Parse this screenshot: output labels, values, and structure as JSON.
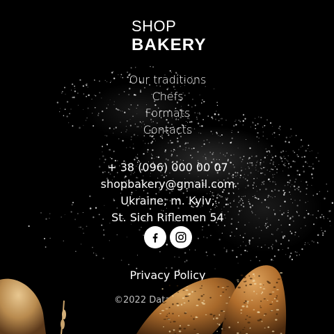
{
  "logo": {
    "line1": "SHOP",
    "line2": "BAKERY"
  },
  "nav": {
    "items": [
      {
        "label": "Our traditions"
      },
      {
        "label": "Chefs"
      },
      {
        "label": "Formats"
      },
      {
        "label": "Contacts"
      }
    ]
  },
  "contacts": {
    "phone": "+ 38 (096) 000 00 07",
    "email": "shopbakery@gmail.com",
    "address_line1": "Ukraine, m. Kyiv,",
    "address_line2": "St. Sich Riflemen 54"
  },
  "social": [
    {
      "icon": "facebook-icon"
    },
    {
      "icon": "instagram-icon"
    }
  ],
  "footer": {
    "privacy": "Privacy Policy",
    "copyright": "©2022 Data"
  },
  "colors": {
    "background": "#000000",
    "text": "#ffffff",
    "muted": "#bdbdbd"
  }
}
